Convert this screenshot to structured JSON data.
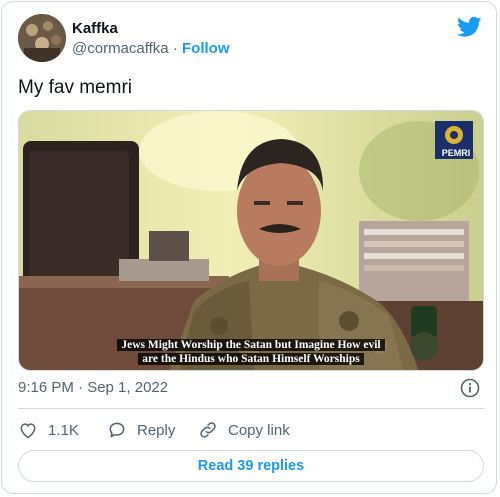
{
  "author": {
    "display_name": "Kaffka",
    "handle": "@cormacaffka",
    "separator": "·",
    "follow_label": "Follow"
  },
  "tweet": {
    "text": "My fav memri",
    "timestamp": "9:16 PM · Sep 1, 2022"
  },
  "media": {
    "logo_text": "PEMRI",
    "caption_line1": "Jews Might Worship the Satan but Imagine How evil",
    "caption_line2": "are the Hindus who Satan Himself Worships"
  },
  "actions": {
    "like_count": "1.1K",
    "reply_label": "Reply",
    "copy_link_label": "Copy link"
  },
  "read_replies_label": "Read 39 replies",
  "colors": {
    "accent": "#1d9bf0",
    "secondary_text": "#536471",
    "border": "#cfd9de"
  }
}
